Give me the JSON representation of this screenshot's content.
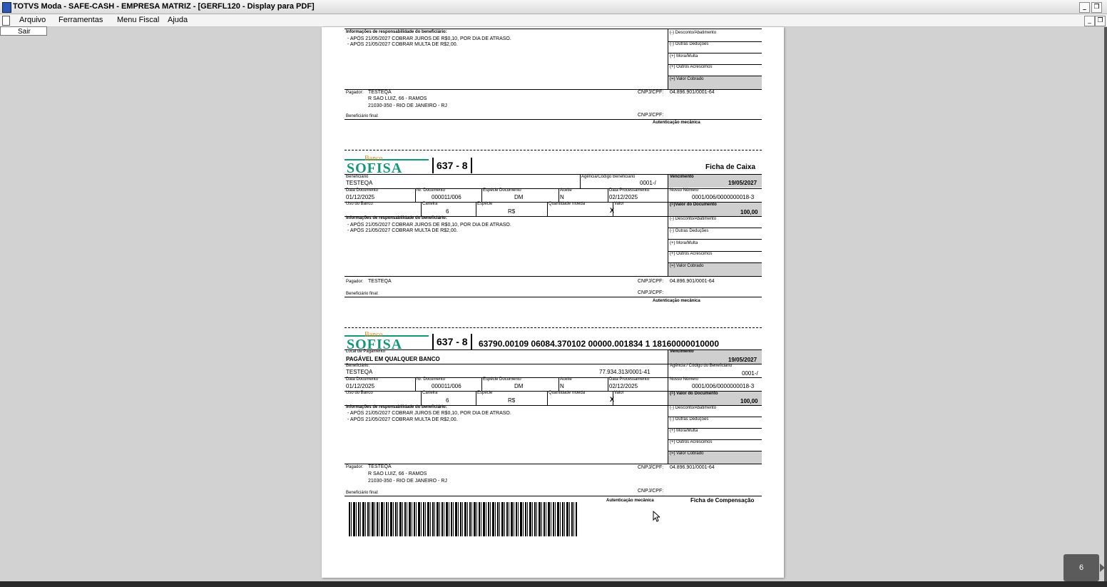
{
  "window": {
    "title": "TOTVS Moda - SAFE-CASH - EMPRESA MATRIZ - [GERFL120 - Display para PDF]",
    "min_label": "_",
    "restore_label": "❐"
  },
  "menu": {
    "items": [
      "Arquivo",
      "Ferramentas",
      "Menu Fiscal",
      "Ajuda"
    ],
    "dropdown_item": "Sair"
  },
  "common": {
    "instr_header": "Informações de responsabilidade do beneficiário:",
    "instr1": "- APÓS 21/05/2027 COBRAR JUROS DE R$0,10, POR DIA DE ATRASO.",
    "instr2": "- APÓS 21/05/2027 COBRAR MULTA DE R$2,00.",
    "desconto": "(-) Desconto/Abatimento",
    "outras_deducoes": "(-) Outras Deduções",
    "mora": "(+) Mora/Multa",
    "outros_acrescimos": "(+) Outros Acréscimos",
    "valor_cobrado": "(=) Valor Cobrado",
    "pagador_label": "Pagador:",
    "pagador_nome": "TESTEQA",
    "pagador_end1": "R SAO LUIZ, 66 - RAMOS",
    "pagador_end2": "21030-350 - RIO DE JANEIRO - RJ",
    "cnpj_label": "CNPJ/CPF:",
    "cnpj_value": "04.896.901/0001-64",
    "benef_final": "Beneficiário final:",
    "autenticacao": "Autenticação mecânica",
    "banco_small": "Banco",
    "banco_name": "SOFISA",
    "bank_code": "637 - 8"
  },
  "caixa": {
    "title": "Ficha de Caixa",
    "beneficiario_label": "Beneficiário",
    "beneficiario": "TESTEQA",
    "agencia_label": "Agência/Código Beneficiário",
    "agencia": "0001-/",
    "vencimento_label": "Vencimento",
    "vencimento": "19/05/2027",
    "data_doc_label": "Data Documento",
    "data_doc": "01/12/2025",
    "nr_doc_label": "Nr. Documento",
    "nr_doc": "000011/006",
    "especie_doc_label": "Espécie Documento",
    "especie_doc": "DM",
    "aceite_label": "Aceite",
    "aceite": "N",
    "data_proc_label": "Data Processamento",
    "data_proc": "02/12/2025",
    "nosso_numero_label": "Nosso Número",
    "nosso_numero": "0001/006/0000000018-3",
    "uso_banco_label": "Uso do Banco",
    "carteira_label": "Carteira",
    "carteira": "6",
    "especie_label": "Espécie",
    "especie": "R$",
    "qtd_moeda_label": "Quantidade moeda",
    "valor_label": "Valor",
    "valor_x": "X",
    "valor_doc_label": "(=)Valor do Documento",
    "valor_doc": "100,00"
  },
  "compensacao": {
    "linha_digitavel": "63790.00109 06084.370102 00000.001834   1   18160000010000",
    "local_pagamento_label": "Local de Pagamento",
    "local_pagamento": "PAGÁVEL EM QUALQUER BANCO",
    "vencimento_label": "Vencimento",
    "vencimento": "19/05/2027",
    "beneficiario_label": "Beneficiário:",
    "beneficiario": "TESTEQA",
    "beneficiario_cnpj": "77.934.313/0001-41",
    "agencia_label": "Agência / Código do Beneficiário",
    "agencia": "0001-/",
    "data_doc_label": "Data Documento",
    "data_doc": "01/12/2025",
    "nr_doc_label": "Nr. Documento",
    "nr_doc": "000011/006",
    "especie_doc_label": "Espécie Documento",
    "especie_doc": "DM",
    "aceite_label": "Aceite",
    "aceite": "N",
    "data_proc_label": "Data Processamento",
    "data_proc": "02/12/2025",
    "nosso_numero_label": "Nosso Número",
    "nosso_numero": "0001/006/0000000018-3",
    "uso_banco_label": "Uso do Banco",
    "carteira_label": "Carteira",
    "carteira": "6",
    "especie_label": "Espécie",
    "especie": "R$",
    "qtd_moeda_label": "Quantidade moeda",
    "valor_label": "Valor",
    "valor_x": "X",
    "valor_doc_label": "(=) Valor do Documento",
    "valor_doc": "100,00",
    "ficha_title": "Ficha de Compensação"
  },
  "pagination": {
    "page": "6"
  }
}
